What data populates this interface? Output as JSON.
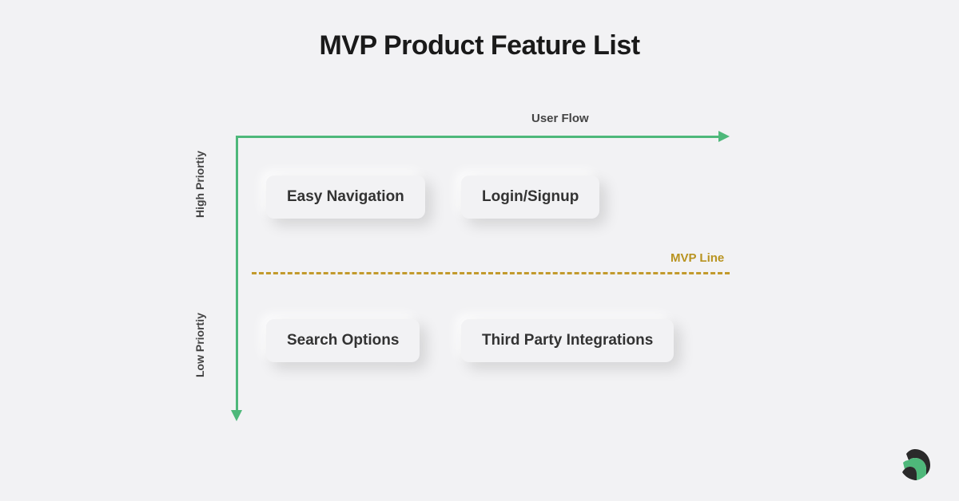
{
  "title": "MVP Product Feature List",
  "axes": {
    "x_label": "User Flow",
    "y_label_high": "High Priortiy",
    "y_label_low": "Low Priortiy"
  },
  "divider": {
    "label": "MVP Line"
  },
  "cards": {
    "top_left": "Easy Navigation",
    "top_right": "Login/Signup",
    "bottom_left": "Search Options",
    "bottom_right": "Third Party Integrations"
  },
  "chart_data": {
    "type": "table",
    "title": "MVP Product Feature List",
    "x_axis": "User Flow",
    "y_axis": "Priority",
    "divider": "MVP Line",
    "quadrants": [
      {
        "priority": "High",
        "features": [
          "Easy Navigation",
          "Login/Signup"
        ]
      },
      {
        "priority": "Low",
        "features": [
          "Search Options",
          "Third Party Integrations"
        ]
      }
    ]
  }
}
